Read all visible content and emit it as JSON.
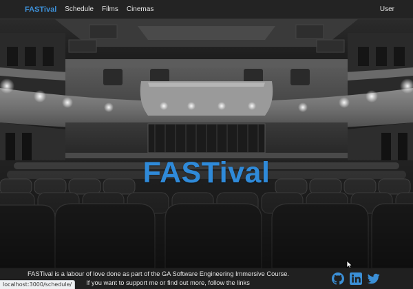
{
  "navbar": {
    "brand": "FASTival",
    "links": [
      "Schedule",
      "Films",
      "Cinemas"
    ],
    "user": "User"
  },
  "hero": {
    "title": "FASTival"
  },
  "footer": {
    "line1": "FASTival is a labour of love done as part of the GA Software Engineering Immersive Course.",
    "line2": "If you want to support me or find out more, follow the links",
    "social": [
      "github-icon",
      "linkedin-icon",
      "twitter-icon"
    ]
  },
  "status_bar": {
    "url": "localhost:3000/schedule/"
  },
  "colors": {
    "brand": "#3d8fd6",
    "hero_title": "#2f8ad9",
    "navbar_bg": "#232323",
    "social_icon": "#3b8fd6"
  }
}
